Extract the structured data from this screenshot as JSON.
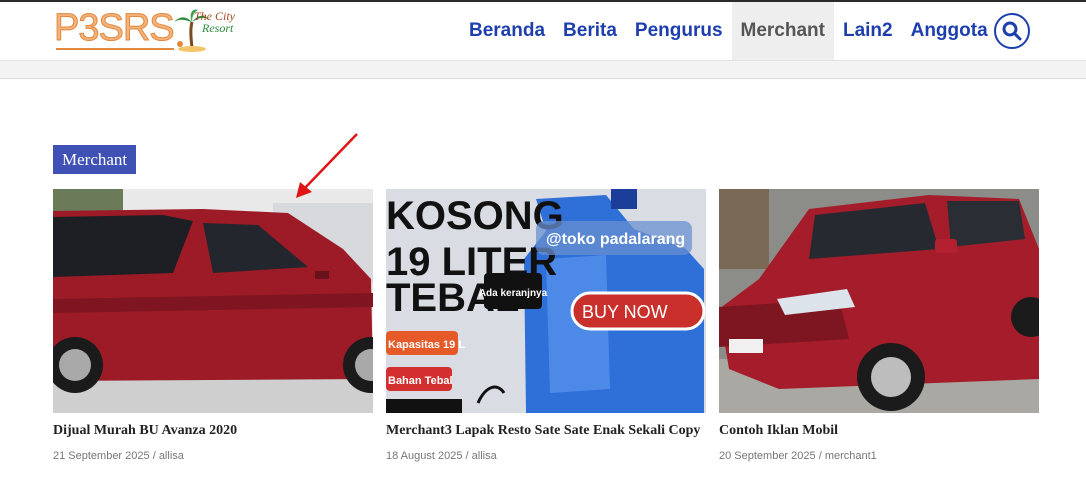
{
  "site": {
    "logo_text": "P3SRS",
    "logo_sub_1": "The City",
    "logo_sub_2": "Resort"
  },
  "nav": {
    "items": [
      {
        "label": "Beranda"
      },
      {
        "label": "Berita"
      },
      {
        "label": "Pengurus"
      },
      {
        "label": "Merchant"
      },
      {
        "label": "Lain2"
      },
      {
        "label": "Anggota"
      }
    ],
    "active": "Merchant"
  },
  "section": {
    "tag": "Merchant"
  },
  "posts": [
    {
      "title": "Dijual Murah BU Avanza 2020",
      "date": "21 September 2025",
      "separator": " / ",
      "author": "allisa"
    },
    {
      "title": "Merchant3 Lapak Resto Sate Sate Enak Sekali Copy",
      "date": "18 August 2025",
      "separator": " / ",
      "author": "allisa",
      "image_text": {
        "line1": "KOSONG",
        "line2": "19 LITER",
        "line3": "TEBAL",
        "badge": "Ada keranjnya",
        "watermark": "@toko padalarang",
        "buy": "BUY NOW",
        "label1": "Kapasitas 19 L",
        "label2": "Bahan Tebal"
      }
    },
    {
      "title": "Contoh Iklan Mobil",
      "date": "20 September 2025",
      "separator": " / ",
      "author": "merchant1"
    }
  ],
  "colors": {
    "nav_link": "#1d3fae",
    "nav_active_bg": "#eeeeee",
    "section_tag_bg": "#3f51b5",
    "annotation_arrow": "#e01515"
  }
}
